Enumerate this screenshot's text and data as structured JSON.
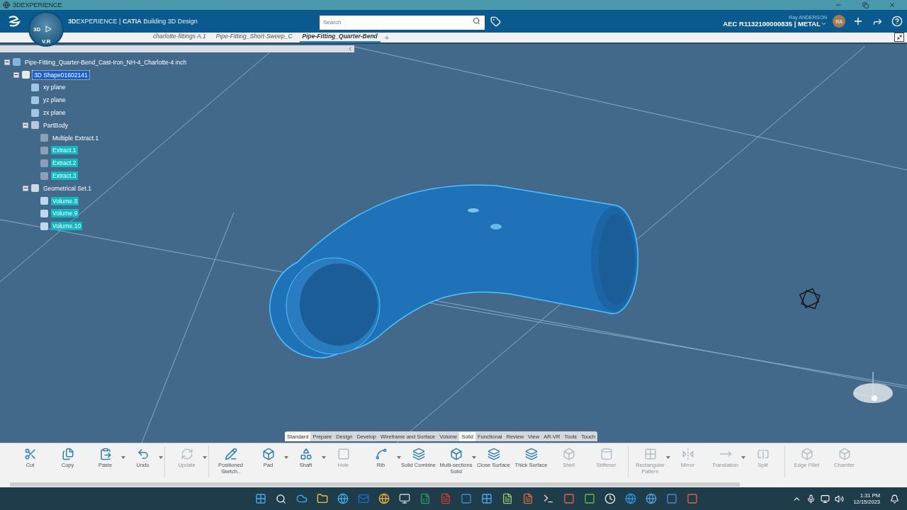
{
  "window": {
    "title": "3DEXPERIENCE"
  },
  "header": {
    "compass": {
      "left": "3D",
      "bottom": "V.R"
    },
    "brand": "**3D**EXPERIENCE | **CATIA** Building 3D Design",
    "search": {
      "placeholder": "Search"
    },
    "user": "Ray ANDERSON",
    "tenant": "AEC R1132100000835 | METAL",
    "avatar": "RA"
  },
  "tabs": [
    {
      "label": "charlotte-fittings A.1",
      "selected": false
    },
    {
      "label": "Pipe-Fitting_Short-Sweep_C",
      "selected": false
    },
    {
      "label": "Pipe-Fitting_Quarter-Bend",
      "selected": true
    }
  ],
  "new_tab": "+",
  "tree": [
    {
      "label": "Pipe-Fitting_Quarter-Bend_Cast-Iron_NH-4_Charlotte-4 inch",
      "kind": "product",
      "selected": false,
      "highlighted": false,
      "expanded": true,
      "children": [
        {
          "label": "3D Shape01602141",
          "kind": "shape",
          "selected": true,
          "highlighted": false,
          "expanded": true,
          "children": [
            {
              "label": "xy plane",
              "kind": "plane",
              "selected": false,
              "highlighted": false
            },
            {
              "label": "yz plane",
              "kind": "plane",
              "selected": false,
              "highlighted": false
            },
            {
              "label": "zx plane",
              "kind": "plane",
              "selected": false,
              "highlighted": false
            },
            {
              "label": "PartBody",
              "kind": "body",
              "selected": false,
              "highlighted": false,
              "expanded": true,
              "children": [
                {
                  "label": "Multiple Extract.1",
                  "kind": "extract",
                  "selected": false,
                  "highlighted": false
                },
                {
                  "label": "Extract.1",
                  "kind": "extract",
                  "selected": false,
                  "highlighted": true
                },
                {
                  "label": "Extract.2",
                  "kind": "extract",
                  "selected": false,
                  "highlighted": true
                },
                {
                  "label": "Extract.3",
                  "kind": "extract",
                  "selected": false,
                  "highlighted": true
                }
              ]
            },
            {
              "label": "Geometrical Set.1",
              "kind": "set",
              "selected": false,
              "highlighted": false,
              "expanded": true,
              "children": [
                {
                  "label": "Volume.8",
                  "kind": "volume",
                  "selected": false,
                  "highlighted": true
                },
                {
                  "label": "Volume.9",
                  "kind": "volume",
                  "selected": false,
                  "highlighted": true
                },
                {
                  "label": "Volume.10",
                  "kind": "volume",
                  "selected": false,
                  "highlighted": true
                }
              ]
            }
          ]
        }
      ]
    }
  ],
  "sections": [
    {
      "label": "Standard",
      "selected": true
    },
    {
      "label": "Prepare",
      "selected": false
    },
    {
      "label": "Design",
      "selected": false
    },
    {
      "label": "Develop",
      "selected": false
    },
    {
      "label": "Wireframe and Surface",
      "selected": false
    },
    {
      "label": "Volume",
      "selected": false
    },
    {
      "label": "Solid",
      "selected": true
    },
    {
      "label": "Functional",
      "selected": false
    },
    {
      "label": "Review",
      "selected": false
    },
    {
      "label": "View",
      "selected": false
    },
    {
      "label": "AR-VR",
      "selected": false
    },
    {
      "label": "Tools",
      "selected": false
    },
    {
      "label": "Touch",
      "selected": false
    }
  ],
  "actions": [
    {
      "kind": "command",
      "label": "Cut",
      "disabled": false,
      "dropdown": false
    },
    {
      "kind": "command",
      "label": "Copy",
      "disabled": false,
      "dropdown": false
    },
    {
      "kind": "command",
      "label": "Paste",
      "disabled": false,
      "dropdown": true
    },
    {
      "kind": "command",
      "label": "Undo",
      "disabled": false,
      "dropdown": true
    },
    {
      "kind": "separator"
    },
    {
      "kind": "command",
      "label": "Update",
      "disabled": true,
      "dropdown": true
    },
    {
      "kind": "separator"
    },
    {
      "kind": "command",
      "label": "Positioned Sketch..",
      "disabled": false,
      "dropdown": false
    },
    {
      "kind": "command",
      "label": "Pad",
      "disabled": false,
      "dropdown": true
    },
    {
      "kind": "command",
      "label": "Shaft",
      "disabled": false,
      "dropdown": true
    },
    {
      "kind": "command",
      "label": "Hole",
      "disabled": true,
      "dropdown": false
    },
    {
      "kind": "command",
      "label": "Rib",
      "disabled": false,
      "dropdown": true
    },
    {
      "kind": "command",
      "label": "Solid Combine",
      "disabled": false,
      "dropdown": false
    },
    {
      "kind": "command",
      "label": "Multi-sections Solid",
      "disabled": false,
      "dropdown": true
    },
    {
      "kind": "command",
      "label": "Close Surface",
      "disabled": false,
      "dropdown": false
    },
    {
      "kind": "command",
      "label": "Thick Surface",
      "disabled": false,
      "dropdown": false
    },
    {
      "kind": "command",
      "label": "Shell",
      "disabled": true,
      "dropdown": false
    },
    {
      "kind": "command",
      "label": "Stiffener",
      "disabled": true,
      "dropdown": false
    },
    {
      "kind": "separator"
    },
    {
      "kind": "command",
      "label": "Rectangular Pattern",
      "disabled": true,
      "dropdown": true
    },
    {
      "kind": "command",
      "label": "Mirror",
      "disabled": true,
      "dropdown": false
    },
    {
      "kind": "command",
      "label": "Translation",
      "disabled": true,
      "dropdown": true
    },
    {
      "kind": "command",
      "label": "Split",
      "disabled": true,
      "dropdown": false
    },
    {
      "kind": "separator"
    },
    {
      "kind": "command",
      "label": "Edge Fillet",
      "disabled": true,
      "dropdown": false
    },
    {
      "kind": "command",
      "label": "Chamfer",
      "disabled": true,
      "dropdown": false
    }
  ],
  "taskbar": {
    "time": "1:31 PM",
    "date": "12/15/2023"
  }
}
